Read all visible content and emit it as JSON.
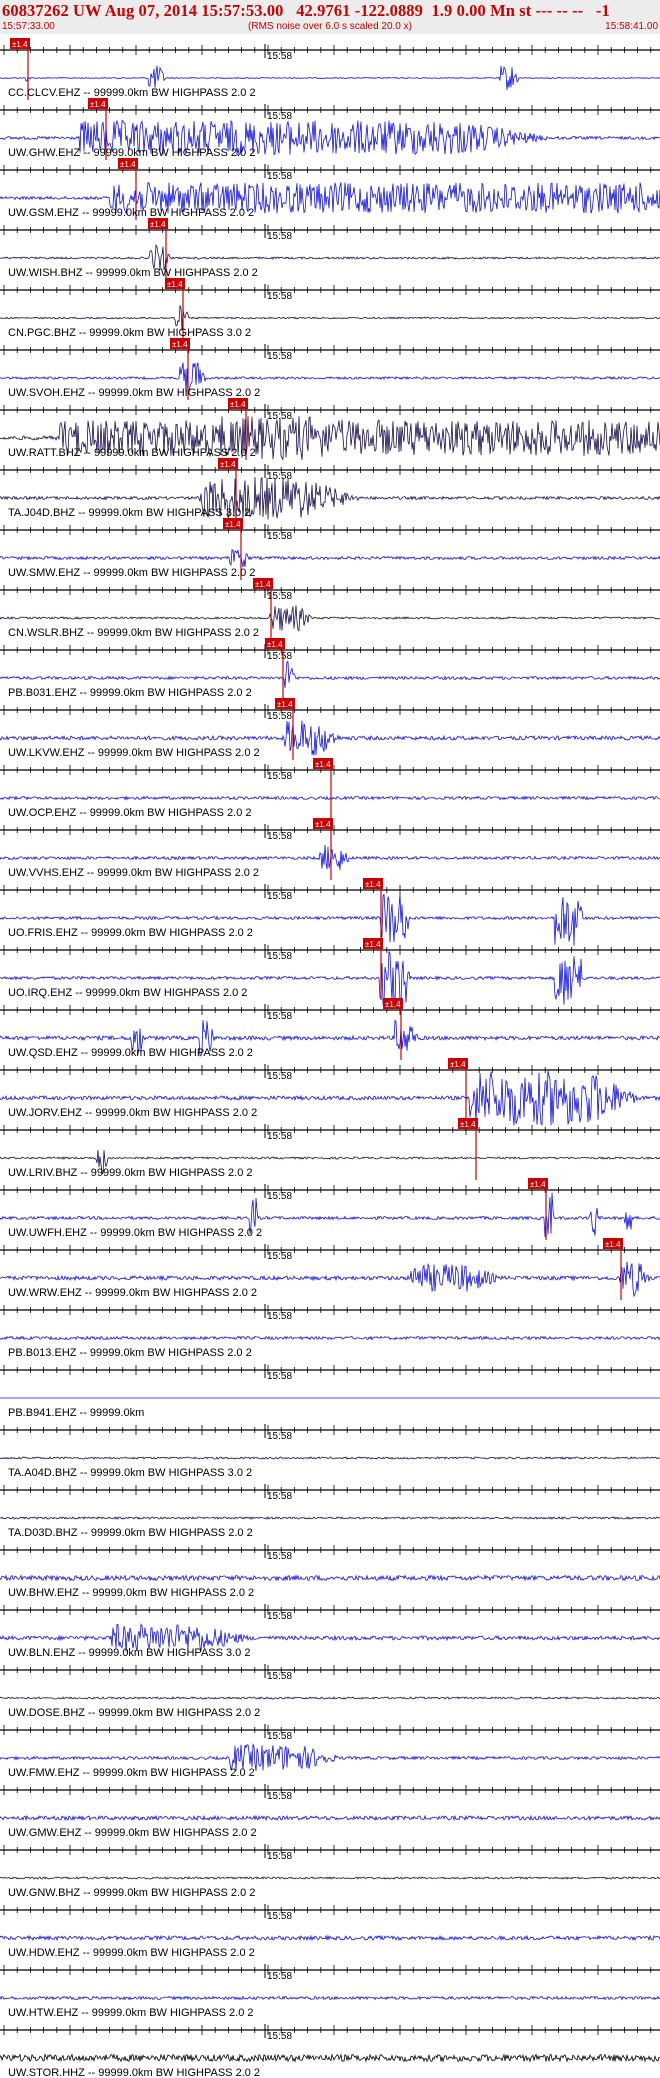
{
  "header": {
    "title": "60837262 UW Aug 07, 2014 15:57:53.00   42.9761 -122.0889  1.9 0.00 Mn st --- -- --   -1",
    "subtitle": "(RMS noise over 6.0 s scaled 20.0 x)",
    "start_time": "15:57:33.00",
    "end_time": "15:58:41.00"
  },
  "colors": {
    "blue": "#1010ee",
    "navy": "#1a1050",
    "black": "#000000",
    "pick": "#cc0000",
    "header_text": "#cc0000"
  },
  "chart_data": {
    "type": "line",
    "title": "60837262 UW Aug 07, 2014 15:57:53.00   42.9761 -122.0889  1.9 0.00 Mn st --- -- --   -1",
    "x_range": [
      "15:57:33.00",
      "15:58:41.00"
    ],
    "tick_label": "15:58",
    "pick_label": "±1.4",
    "series": [
      {
        "name": "CC.CLCV.EHZ -- 99999.0km BW  HIGHPASS  2.0  2",
        "color": "blue",
        "pick": 10,
        "amp": 0.5,
        "bursts": [
          [
            26,
            28,
            3,
            0.8
          ],
          [
            148,
            160,
            6,
            3
          ],
          [
            500,
            515,
            4,
            3
          ]
        ]
      },
      {
        "name": "UW.GHW.EHZ -- 99999.0km BW  HIGHPASS  2.0  2",
        "color": "blue",
        "pick": 88,
        "amp": 1.5,
        "bursts": [
          [
            80,
            460,
            90,
            4
          ],
          [
            180,
            240,
            40,
            3
          ]
        ]
      },
      {
        "name": "UW.GSM.EHZ -- 99999.0km BW  HIGHPASS  2.0  2",
        "color": "blue",
        "pick": 118,
        "amp": 1.5,
        "bursts": [
          [
            110,
            640,
            130,
            3.5
          ],
          [
            600,
            650,
            20,
            2
          ]
        ]
      },
      {
        "name": "UW.WISH.BHZ -- 99999.0km BW  HIGHPASS  2.0  2",
        "color": "navy",
        "pick": 148,
        "amp": 1,
        "bursts": [
          [
            150,
            165,
            5,
            3
          ]
        ]
      },
      {
        "name": "CN.PGC.BHZ -- 99999.0km BW  HIGHPASS  3.0  2",
        "color": "navy",
        "pick": 165,
        "amp": 0.8,
        "bursts": [
          [
            175,
            185,
            4,
            3
          ]
        ]
      },
      {
        "name": "UW.SVOH.EHZ -- 99999.0km BW  HIGHPASS  2.0  2",
        "color": "blue",
        "pick": 170,
        "amp": 1.2,
        "bursts": [
          [
            180,
            200,
            6,
            4
          ]
        ]
      },
      {
        "name": "UW.RATT.BHZ -- 99999.0km BW  HIGHPASS  2.0  2",
        "color": "navy",
        "pick": 228,
        "amp": 2,
        "bursts": [
          [
            60,
            650,
            160,
            4
          ],
          [
            220,
            320,
            40,
            5
          ],
          [
            350,
            460,
            40,
            4
          ],
          [
            560,
            620,
            20,
            4
          ]
        ]
      },
      {
        "name": "TA.J04D.BHZ -- 99999.0km BW  HIGHPASS  3.0  2",
        "color": "navy",
        "pick": 218,
        "amp": 1.5,
        "bursts": [
          [
            200,
            300,
            60,
            5
          ]
        ]
      },
      {
        "name": "UW.SMW.EHZ -- 99999.0km BW  HIGHPASS  2.0  2",
        "color": "blue",
        "pick": 223,
        "amp": 1.5,
        "bursts": [
          [
            230,
            245,
            5,
            2
          ]
        ]
      },
      {
        "name": "CN.WSLR.BHZ -- 99999.0km BW  HIGHPASS  2.0  2",
        "color": "navy",
        "pick": 253,
        "amp": 1,
        "bursts": [
          [
            270,
            300,
            12,
            3
          ]
        ]
      },
      {
        "name": "PB.B031.EHZ -- 99999.0km BW  HIGHPASS  2.0  2",
        "color": "blue",
        "pick": 265,
        "amp": 1.5,
        "bursts": [
          [
            285,
            292,
            4,
            4
          ]
        ]
      },
      {
        "name": "UW.LKVW.EHZ -- 99999.0km BW  HIGHPASS  2.0  2",
        "color": "blue",
        "pick": 275,
        "amp": 2,
        "bursts": [
          [
            285,
            320,
            20,
            4
          ]
        ]
      },
      {
        "name": "UW.OCP.EHZ -- 99999.0km BW  HIGHPASS  2.0  2",
        "color": "blue",
        "pick": 313,
        "amp": 1.5,
        "bursts": []
      },
      {
        "name": "UW.VVHS.EHZ -- 99999.0km BW  HIGHPASS  2.0  2",
        "color": "blue",
        "pick": 313,
        "amp": 1.5,
        "bursts": [
          [
            320,
            340,
            10,
            3
          ]
        ]
      },
      {
        "name": "UO.FRIS.EHZ -- 99999.0km BW  HIGHPASS  2.0  2",
        "color": "blue",
        "pick": 363,
        "amp": 1.5,
        "bursts": [
          [
            380,
            400,
            10,
            20
          ],
          [
            555,
            575,
            8,
            20
          ]
        ]
      },
      {
        "name": "UO.IRQ.EHZ -- 99999.0km BW  HIGHPASS  2.0  2",
        "color": "blue",
        "pick": 363,
        "amp": 1.5,
        "bursts": [
          [
            380,
            400,
            10,
            20
          ],
          [
            555,
            575,
            8,
            20
          ]
        ]
      },
      {
        "name": "UW.QSD.EHZ -- 99999.0km BW  HIGHPASS  2.0  2",
        "color": "blue",
        "pick": 383,
        "amp": 2,
        "bursts": [
          [
            130,
            140,
            4,
            4
          ],
          [
            200,
            210,
            5,
            4
          ],
          [
            395,
            410,
            8,
            4
          ]
        ]
      },
      {
        "name": "UW.JORV.EHZ -- 99999.0km BW  HIGHPASS  2.0  2",
        "color": "blue",
        "pick": 448,
        "amp": 2,
        "bursts": [
          [
            470,
            580,
            60,
            8
          ]
        ]
      },
      {
        "name": "UW.LRIV.BHZ -- 99999.0km BW  HIGHPASS  2.0  2",
        "color": "navy",
        "pick": 458,
        "amp": 1,
        "bursts": [
          [
            95,
            105,
            3,
            4
          ]
        ]
      },
      {
        "name": "UW.UWFH.EHZ -- 99999.0km BW  HIGHPASS  2.0  2",
        "color": "blue",
        "pick": 528,
        "amp": 1.5,
        "bursts": [
          [
            250,
            256,
            2,
            5
          ],
          [
            545,
            552,
            2,
            6
          ],
          [
            590,
            596,
            2,
            6
          ],
          [
            625,
            630,
            2,
            6
          ]
        ]
      },
      {
        "name": "UW.WRW.EHZ -- 99999.0km BW  HIGHPASS  2.0  2",
        "color": "blue",
        "pick": 603,
        "amp": 2,
        "bursts": [
          [
            410,
            470,
            30,
            3
          ],
          [
            620,
            640,
            10,
            4
          ]
        ]
      },
      {
        "name": "PB.B013.EHZ -- 99999.0km BW  HIGHPASS  2.0  2",
        "color": "blue",
        "pick": null,
        "amp": 1.5,
        "bursts": []
      },
      {
        "name": "PB.B941.EHZ -- 99999.0km",
        "color": "blue",
        "pick": null,
        "amp": 0,
        "bursts": []
      },
      {
        "name": "TA.A04D.BHZ -- 99999.0km BW  HIGHPASS  3.0  2",
        "color": "navy",
        "pick": null,
        "amp": 1,
        "bursts": []
      },
      {
        "name": "TA.D03D.BHZ -- 99999.0km BW  HIGHPASS  2.0  2",
        "color": "navy",
        "pick": null,
        "amp": 1,
        "bursts": []
      },
      {
        "name": "UW.BHW.EHZ -- 99999.0km BW  HIGHPASS  2.0  2",
        "color": "blue",
        "pick": null,
        "amp": 2.5,
        "bursts": []
      },
      {
        "name": "UW.BLN.EHZ -- 99999.0km BW  HIGHPASS  3.0  2",
        "color": "blue",
        "pick": null,
        "amp": 2,
        "bursts": [
          [
            110,
            200,
            50,
            3
          ]
        ]
      },
      {
        "name": "UW.DOSE.BHZ -- 99999.0km BW  HIGHPASS  2.0  2",
        "color": "navy",
        "pick": null,
        "amp": 1,
        "bursts": []
      },
      {
        "name": "UW.FMW.EHZ -- 99999.0km BW  HIGHPASS  2.0  2",
        "color": "blue",
        "pick": null,
        "amp": 1.5,
        "bursts": [
          [
            230,
            300,
            40,
            3
          ]
        ]
      },
      {
        "name": "UW.GMW.EHZ -- 99999.0km BW  HIGHPASS  2.0  2",
        "color": "blue",
        "pick": null,
        "amp": 2,
        "bursts": []
      },
      {
        "name": "UW.GNW.BHZ -- 99999.0km BW  HIGHPASS  2.0  2",
        "color": "navy",
        "pick": null,
        "amp": 1,
        "bursts": []
      },
      {
        "name": "UW.HDW.EHZ -- 99999.0km BW  HIGHPASS  2.0  2",
        "color": "blue",
        "pick": null,
        "amp": 2,
        "bursts": []
      },
      {
        "name": "UW.HTW.EHZ -- 99999.0km BW  HIGHPASS  2.0  2",
        "color": "blue",
        "pick": null,
        "amp": 1.5,
        "bursts": []
      },
      {
        "name": "UW.STOR.HHZ -- 99999.0km BW  HIGHPASS  2.0  2",
        "color": "black",
        "pick": null,
        "amp": 3.5,
        "bursts": []
      }
    ]
  }
}
